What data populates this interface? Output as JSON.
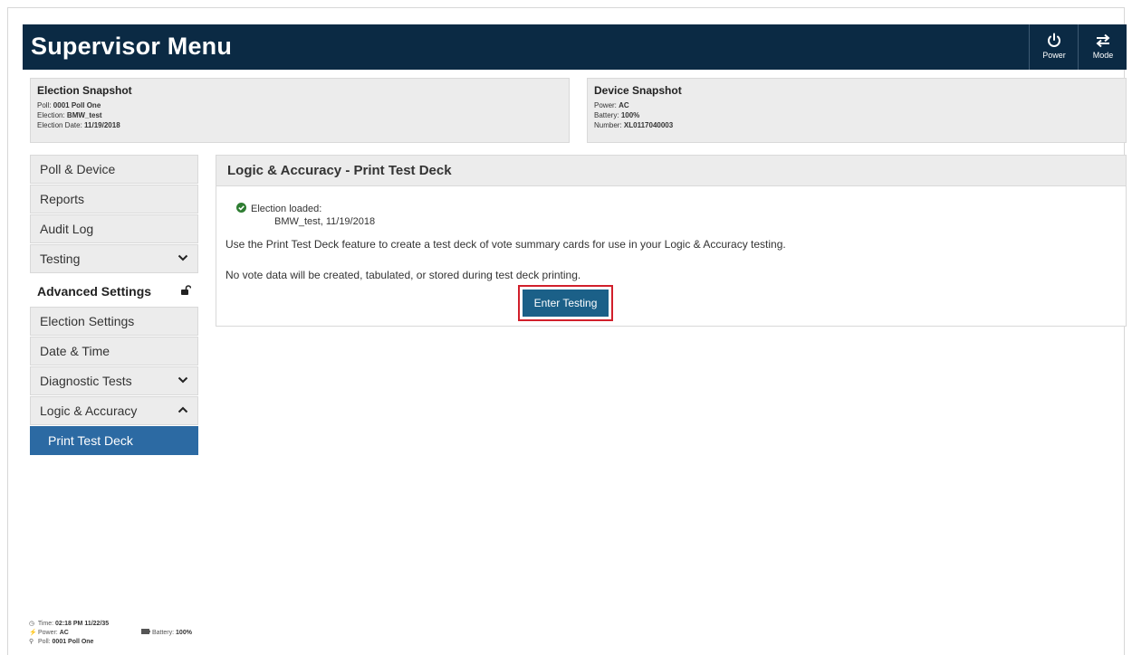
{
  "header": {
    "title": "Supervisor Menu",
    "power_label": "Power",
    "mode_label": "Mode"
  },
  "election_snapshot": {
    "title": "Election Snapshot",
    "poll_label": "Poll:",
    "poll_value": "0001 Poll One",
    "election_label": "Election:",
    "election_value": "BMW_test",
    "date_label": "Election Date:",
    "date_value": "11/19/2018"
  },
  "device_snapshot": {
    "title": "Device Snapshot",
    "power_label": "Power:",
    "power_value": "AC",
    "battery_label": "Battery:",
    "battery_value": "100%",
    "number_label": "Number:",
    "number_value": "XL0117040003"
  },
  "sidebar": {
    "items": [
      {
        "label": "Poll & Device"
      },
      {
        "label": "Reports"
      },
      {
        "label": "Audit Log"
      },
      {
        "label": "Testing",
        "chevron": "down"
      }
    ],
    "section_label": "Advanced Settings",
    "advanced_items": [
      {
        "label": "Election Settings"
      },
      {
        "label": "Date & Time"
      },
      {
        "label": "Diagnostic Tests",
        "chevron": "down"
      },
      {
        "label": "Logic & Accuracy",
        "chevron": "up"
      },
      {
        "label": "Print Test Deck",
        "active": true
      }
    ]
  },
  "main": {
    "title": "Logic & Accuracy - Print Test Deck",
    "loaded_label": "Election loaded:",
    "loaded_detail": "BMW_test, 11/19/2018",
    "paragraph1": "Use the Print Test Deck feature to create a test deck of vote summary cards for use in your Logic & Accuracy testing.",
    "paragraph2": "No vote data will be created, tabulated, or stored during test deck printing.",
    "button_label": "Enter Testing"
  },
  "footer": {
    "time_label": "Time:",
    "time_value": "02:18 PM 11/22/35",
    "power_label": "Power:",
    "power_value": "AC",
    "battery_label": "Battery:",
    "battery_value": "100%",
    "poll_label": "Poll:",
    "poll_value": "0001 Poll One"
  },
  "colors": {
    "header_bg": "#0b2a44",
    "active_item_bg": "#2c6aa3",
    "button_bg": "#1b6088",
    "highlight_border": "#d11f2b",
    "success_green": "#2e7d32"
  }
}
